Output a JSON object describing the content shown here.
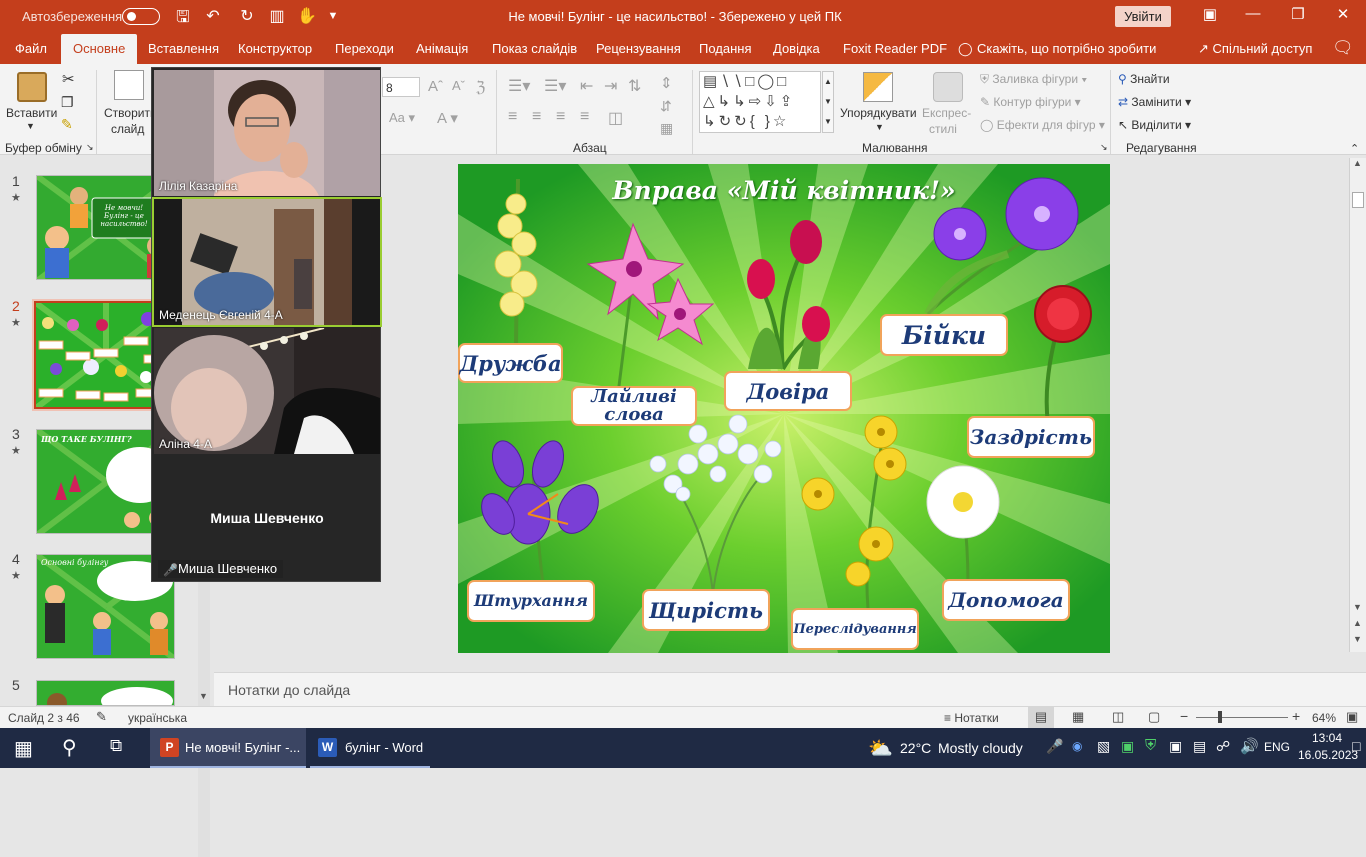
{
  "titlebar": {
    "autosave": "Автозбереження",
    "title": "Не мовчі! Булінг - це насильство!  -  Збережено у цей ПК",
    "signin": "Увійти"
  },
  "tabs": [
    "Файл",
    "Основне",
    "Вставлення",
    "Конструктор",
    "Переходи",
    "Анімація",
    "Показ слайдів",
    "Рецензування",
    "Подання",
    "Довідка",
    "Foxit Reader PDF",
    "Скажіть, що потрібно зробити",
    "Спільний доступ"
  ],
  "ribbon": {
    "paste": "Вставити",
    "new_slide_1": "Створити",
    "new_slide_2": "слайд",
    "font_size": "8",
    "clipboard": "Буфер обміну",
    "paragraph": "Абзац",
    "drawing": "Малювання",
    "editing": "Редагування",
    "arrange": "Упорядкувати",
    "quick_styles_1": "Експрес-",
    "quick_styles_2": "стилі",
    "shape_fill": "Заливка фігури",
    "shape_outline": "Контур фігури",
    "shape_effects": "Ефекти для фігур",
    "find": "Знайти",
    "replace": "Замінити",
    "select": "Виділити"
  },
  "slides": [
    {
      "num": "1",
      "caption": "Не мовчи! Булінг - це насильство!"
    },
    {
      "num": "2",
      "caption": "Вправа «Мій квітник!»"
    },
    {
      "num": "3",
      "caption": "ЩО ТАКЕ БУЛІНГ?"
    },
    {
      "num": "4",
      "caption": "Основні булінгу"
    },
    {
      "num": "5",
      "caption": ""
    }
  ],
  "slide": {
    "title": "Вправа «Мій квітник!»",
    "labels": [
      "Дружба",
      "Лайливі слова",
      "Довіра",
      "Бійки",
      "Заздрість",
      "Штурхання",
      "Щирість",
      "Переслідування",
      "Допомога"
    ]
  },
  "notes": "Нотатки до слайда",
  "zoom": {
    "participants": [
      "Лілія Казаріна",
      "Меденець Євгеній 4-А",
      "Аліна 4-А"
    ],
    "no_video_name": "Миша Шевченко",
    "no_video_label": "Миша Шевченко"
  },
  "status": {
    "slide_of": "Слайд 2 з 46",
    "language": "українська",
    "notes": "Нотатки",
    "zoom": "64%"
  },
  "taskbar": {
    "ppt_title": "Не мовчі! Булінг -...",
    "word_title": "булінг - Word",
    "weather_temp": "22°C",
    "weather_desc": "Mostly cloudy",
    "lang": "ENG",
    "time": "13:04",
    "date": "16.05.2023"
  },
  "colors": {
    "accent": "#c43e1c",
    "slide_green": "#2bb02a",
    "label_text": "#1d3b78",
    "label_border": "#f1a35a"
  }
}
